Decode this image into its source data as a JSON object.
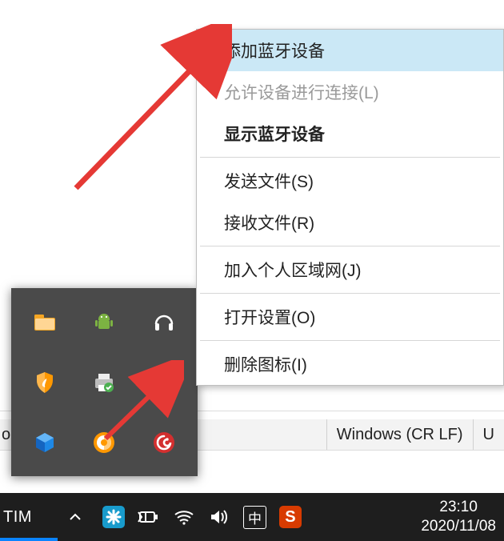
{
  "menu": {
    "items": [
      {
        "label": "添加蓝牙设备",
        "style": "highlight"
      },
      {
        "label": "允许设备进行连接(L)",
        "style": "disabled"
      },
      {
        "label": "显示蓝牙设备",
        "style": "bold"
      }
    ],
    "group2": [
      {
        "label": "发送文件(S)"
      },
      {
        "label": "接收文件(R)"
      }
    ],
    "group3": [
      {
        "label": "加入个人区域网(J)"
      }
    ],
    "group4": [
      {
        "label": "打开设置(O)"
      }
    ],
    "group5": [
      {
        "label": "删除图标(I)"
      }
    ]
  },
  "statusbar": {
    "left_fragment": "ol",
    "encoding": "Windows (CR LF)",
    "right_fragment": "U"
  },
  "taskbar": {
    "app": "TIM",
    "ime_label": "中",
    "time": "23:10",
    "date": "2020/11/08"
  },
  "tray_icons": {
    "r0c0": "folder-icon",
    "r0c1": "android-icon",
    "r0c2": "headset-icon",
    "r1c0": "shield-icon",
    "r1c1": "printer-icon",
    "r1c2": "bluetooth-icon",
    "r2c0": "cube-icon",
    "r2c1": "browser-icon",
    "r2c2": "netease-music-icon"
  }
}
